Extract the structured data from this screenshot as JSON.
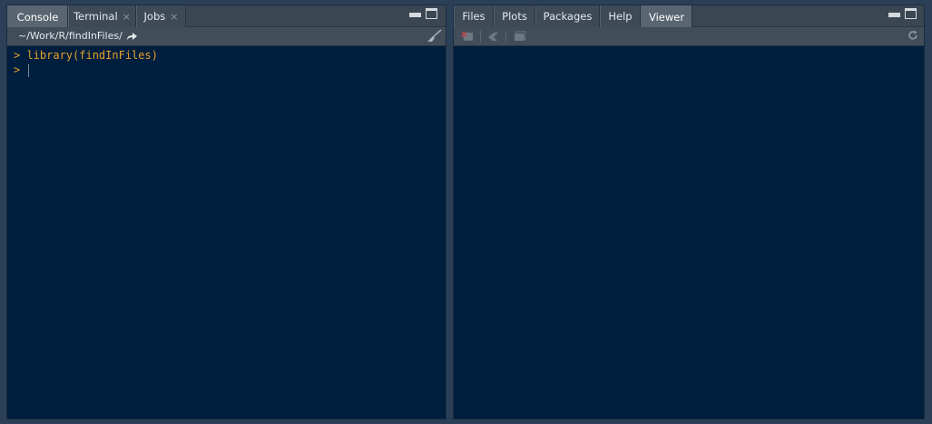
{
  "left_pane": {
    "tabs": [
      {
        "label": "Console",
        "closable": false,
        "active": true
      },
      {
        "label": "Terminal",
        "closable": true,
        "active": false
      },
      {
        "label": "Jobs",
        "closable": true,
        "active": false
      }
    ],
    "close_glyph": "×",
    "path": "~/Work/R/findInFiles/",
    "console_lines": [
      {
        "prompt": ">",
        "text": " library(findInFiles)"
      },
      {
        "prompt": ">",
        "text": " "
      }
    ]
  },
  "right_pane": {
    "tabs": [
      {
        "label": "Files",
        "active": false
      },
      {
        "label": "Plots",
        "active": false
      },
      {
        "label": "Packages",
        "active": false
      },
      {
        "label": "Help",
        "active": false
      },
      {
        "label": "Viewer",
        "active": true
      }
    ]
  },
  "colors": {
    "background": "#2b3f56",
    "console_bg": "#001e3d",
    "console_text": "#e6a22d",
    "tab_bar": "#3a4652",
    "active_tab": "#596571"
  },
  "icons": {
    "go_to_dir": "arrow-forward-icon",
    "clear": "broom-icon",
    "remove_viewer": "remove-viewer-icon",
    "clear_all": "clear-all-icon",
    "export": "export-icon",
    "refresh": "refresh-icon"
  }
}
